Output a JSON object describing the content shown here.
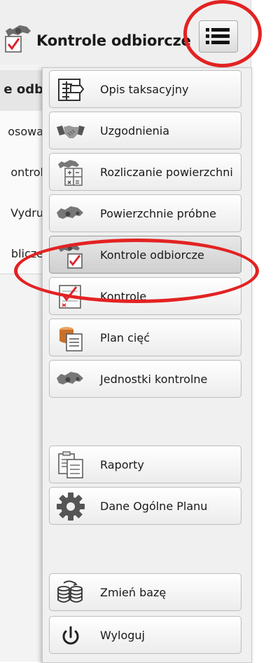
{
  "header": {
    "title": "Kontrole odbiorcze",
    "icon": "gear-check-icon",
    "menu_icon": "menu-list-icon"
  },
  "background_list": {
    "header": "e odb",
    "rows": [
      "osowa",
      "ontrol",
      "Vydru",
      "bliczе"
    ]
  },
  "menu": {
    "items": [
      {
        "label": "Opis taksacyjny",
        "icon": "stand-sign-icon"
      },
      {
        "label": "Uzgodnienia",
        "icon": "handshake-icon"
      },
      {
        "label": "Rozliczanie powierzchni",
        "icon": "calculator-gear-icon"
      },
      {
        "label": "Powierzchnie próbne",
        "icon": "gears-icon"
      },
      {
        "label": "Kontrole odbiorcze",
        "icon": "gear-check-icon",
        "active": true
      },
      {
        "label": "Kontrole",
        "icon": "checklist-icon"
      },
      {
        "label": "Plan cięć",
        "icon": "stump-document-icon"
      },
      {
        "label": "Jednostki kontrolne",
        "icon": "gears-icon"
      },
      {
        "label": "Raporty",
        "icon": "reports-icon"
      },
      {
        "label": "Dane Ogólne Planu",
        "icon": "gear-icon"
      },
      {
        "label": "Zmień bazę",
        "icon": "database-icon"
      },
      {
        "label": "Wyloguj",
        "icon": "power-icon"
      }
    ]
  },
  "colors": {
    "annotation_red": "#e32222",
    "check_red": "#d9262e"
  }
}
